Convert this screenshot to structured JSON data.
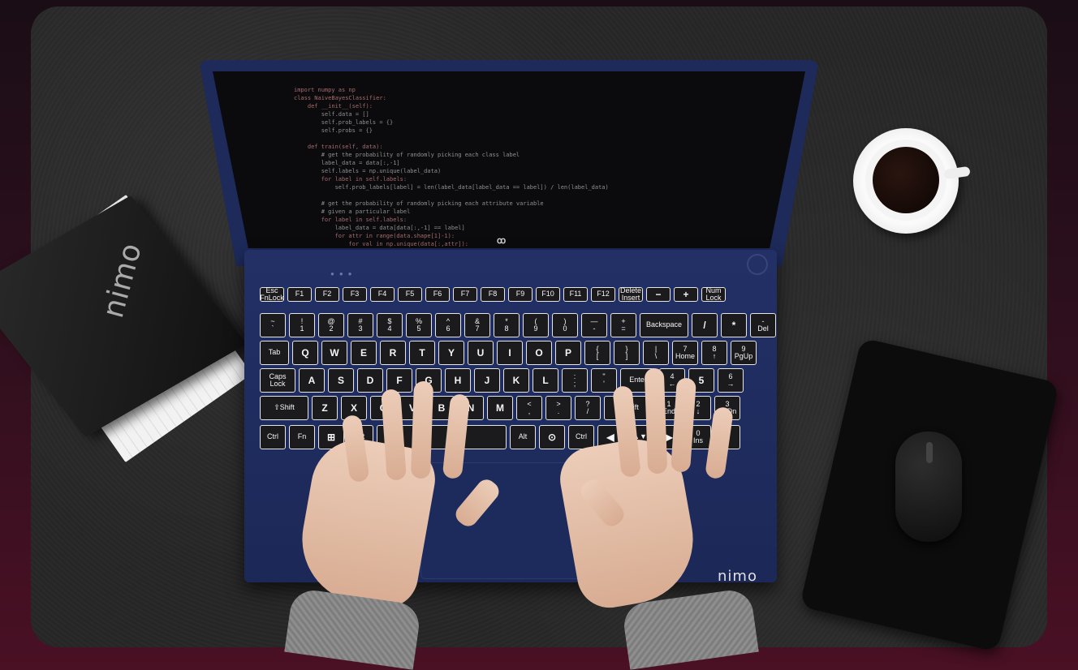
{
  "scene": {
    "notebook_logo": "nimo",
    "screen_logo": "ꝏ",
    "laptop_brand": "nimo",
    "code_lines": [
      "import numpy as np",
      "class NaiveBayesClassifier:",
      "    def __init__(self):",
      "        self.data = []",
      "        self.prob_labels = {}",
      "        self.probs = {}",
      "",
      "    def train(self, data):",
      "        # get the probability of randomly picking each class label",
      "        label_data = data[:,-1]",
      "        self.labels = np.unique(label_data)",
      "        for label in self.labels:",
      "            self.prob_labels[label] = len(label_data[label_data == label]) / len(label_data)",
      "",
      "        # get the probability of randomly picking each attribute variable",
      "        # given a particular label",
      "        for label in self.labels:",
      "            label_data = data[data[:,-1] == label]",
      "            for attr in range(data.shape[1]-1):",
      "                for val in np.unique(data[:,attr]):"
    ],
    "keyboard": {
      "rows": [
        [
          "Esc\nFnLock",
          "F1",
          "F2",
          "F3",
          "F4",
          "F5",
          "F6",
          "F7",
          "F8",
          "F9",
          "F10",
          "F11",
          "F12",
          "Delete\nInsert",
          "−",
          "+",
          "Num\nLock"
        ],
        [
          "~\n`",
          "!\n1",
          "@\n2",
          "#\n3",
          "$\n4",
          "%\n5",
          "^\n6",
          "&\n7",
          "*\n8",
          "(\n9",
          ")\n0",
          "—\n-",
          "+\n=",
          "Backspace",
          "/",
          "*",
          "-\nDel"
        ],
        [
          "Tab",
          "Q",
          "W",
          "E",
          "R",
          "T",
          "Y",
          "U",
          "I",
          "O",
          "P",
          "{\n[",
          "}\n]",
          "|\n\\",
          "7\nHome",
          "8\n↑",
          "9\nPgUp"
        ],
        [
          "Caps\nLock",
          "A",
          "S",
          "D",
          "F",
          "G",
          "H",
          "J",
          "K",
          "L",
          ":\n;",
          "\"\n'",
          "Enter",
          "4\n←",
          "5",
          "6\n→"
        ],
        [
          "⇧Shift",
          "Z",
          "X",
          "C",
          "V",
          "B",
          "N",
          "M",
          "<\n,",
          ">\n.",
          "?\n/",
          "⇧Shift",
          "1\nEnd",
          "2\n↓",
          "3\nPgDn"
        ],
        [
          "Ctrl",
          "Fn",
          "⊞",
          "Alt",
          "",
          "Alt",
          "⊙",
          "Ctrl",
          "◀",
          "▲▼",
          "▶",
          "0\nIns",
          "."
        ]
      ]
    }
  }
}
